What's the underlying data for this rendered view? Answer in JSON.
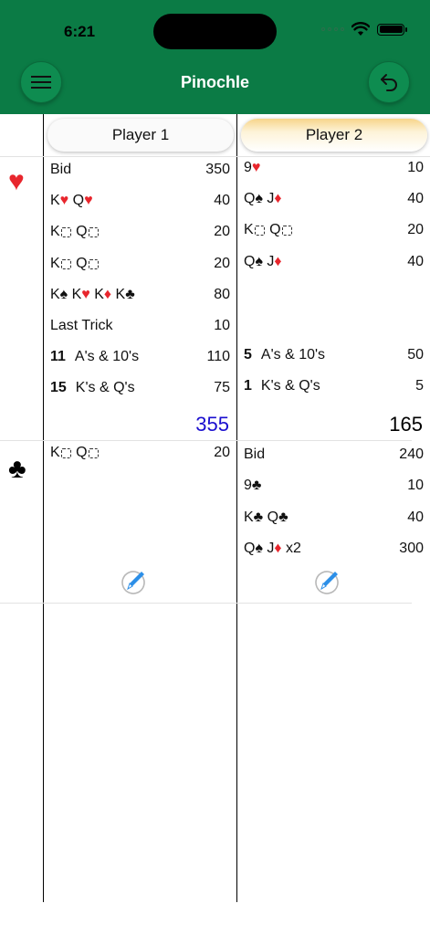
{
  "status": {
    "time": "6:21"
  },
  "header": {
    "title": "Pinochle",
    "menu_icon": "hamburger-menu-icon",
    "undo_icon": "undo-arrow-icon"
  },
  "players": [
    {
      "name": "Player 1",
      "active": false
    },
    {
      "name": "Player 2",
      "active": true
    }
  ],
  "colors": {
    "header_green": "#0b7b45",
    "suit_red": "#e8262d",
    "total_blue": "#1a0ecf"
  },
  "hands": [
    {
      "trump_suit": "♥",
      "player1": {
        "rows": [
          {
            "parts": [
              {
                "t": "Bid"
              }
            ],
            "points": "350"
          },
          {
            "parts": [
              {
                "t": "K"
              },
              {
                "t": "♥",
                "c": "red"
              },
              {
                "t": " Q"
              },
              {
                "t": "♥",
                "c": "red"
              }
            ],
            "points": "40"
          },
          {
            "parts": [
              {
                "t": "K"
              },
              {
                "box": true
              },
              {
                "t": " Q"
              },
              {
                "box": true
              }
            ],
            "points": "20"
          },
          {
            "parts": [
              {
                "t": "K"
              },
              {
                "box": true
              },
              {
                "t": " Q"
              },
              {
                "box": true
              }
            ],
            "points": "20"
          },
          {
            "parts": [
              {
                "t": "K"
              },
              {
                "t": "♠"
              },
              {
                "t": " K"
              },
              {
                "t": "♥",
                "c": "red"
              },
              {
                "t": " K"
              },
              {
                "t": "♦",
                "c": "red"
              },
              {
                "t": " K"
              },
              {
                "t": "♣"
              }
            ],
            "points": "80"
          },
          {
            "parts": [
              {
                "t": "Last Trick"
              }
            ],
            "points": "10"
          },
          {
            "count": "11",
            "parts": [
              {
                "t": "A's & 10's"
              }
            ],
            "points": "110"
          },
          {
            "count": "15",
            "parts": [
              {
                "t": "K's & Q's"
              }
            ],
            "points": "75"
          }
        ],
        "total": "355"
      },
      "player2": {
        "rows": [
          {
            "parts": [
              {
                "t": "9"
              },
              {
                "t": "♥",
                "c": "red"
              }
            ],
            "points": "10"
          },
          {
            "parts": [
              {
                "t": "Q"
              },
              {
                "t": "♠"
              },
              {
                "t": " J"
              },
              {
                "t": "♦",
                "c": "red"
              }
            ],
            "points": "40"
          },
          {
            "parts": [
              {
                "t": "K"
              },
              {
                "box": true
              },
              {
                "t": " Q"
              },
              {
                "box": true
              }
            ],
            "points": "20"
          },
          {
            "parts": [
              {
                "t": "Q"
              },
              {
                "t": "♠"
              },
              {
                "t": " J"
              },
              {
                "t": "♦",
                "c": "red"
              }
            ],
            "points": "40"
          },
          {
            "parts": [],
            "points": ""
          },
          {
            "parts": [],
            "points": ""
          },
          {
            "count": "5",
            "parts": [
              {
                "t": "A's & 10's"
              }
            ],
            "points": "50"
          },
          {
            "count": "1",
            "parts": [
              {
                "t": "K's & Q's"
              }
            ],
            "points": "5"
          }
        ],
        "total": "165"
      }
    },
    {
      "trump_suit": "♣",
      "player1": {
        "rows": [
          {
            "parts": [
              {
                "t": "K"
              },
              {
                "box": true
              },
              {
                "t": " Q"
              },
              {
                "box": true
              }
            ],
            "points": "20"
          }
        ]
      },
      "player2": {
        "rows": [
          {
            "parts": [
              {
                "t": "Bid"
              }
            ],
            "points": "240"
          },
          {
            "parts": [
              {
                "t": "9"
              },
              {
                "t": "♣"
              }
            ],
            "points": "10"
          },
          {
            "parts": [
              {
                "t": "K"
              },
              {
                "t": "♣"
              },
              {
                "t": " Q"
              },
              {
                "t": "♣"
              }
            ],
            "points": "40"
          },
          {
            "parts": [
              {
                "t": "Q"
              },
              {
                "t": "♠"
              },
              {
                "t": " J"
              },
              {
                "t": "♦",
                "c": "red"
              },
              {
                "t": " x2"
              }
            ],
            "points": "300"
          }
        ]
      }
    }
  ]
}
